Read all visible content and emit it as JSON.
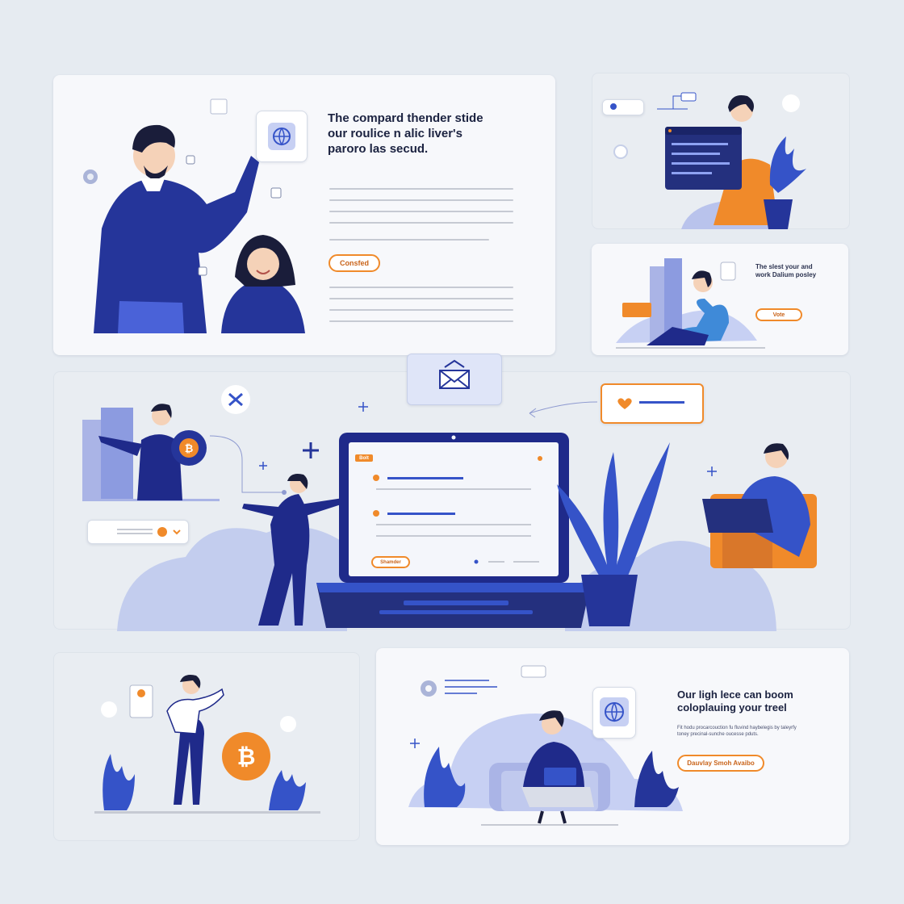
{
  "panels": {
    "top_left": {
      "heading": "The compard thender stide\nour roulice n alic liver's\nparoro las secud.",
      "button_label": "Consfed"
    },
    "mid_right": {
      "heading": "The slest your and\nwork Dalium posley",
      "button_label": "Vote"
    },
    "laptop_screen": {
      "tag_label": "Bolt",
      "button_label": "Shamder"
    },
    "bottom_right": {
      "heading": "Our ligh lece can boom\ncoloplauing your treel",
      "subtext": "Fit hodu procarcouction fu fluvind haybelegis by taleyrfy\ntoney precinal-sunche oucesse pduts.",
      "button_label": "Dauvlay Smoh Avaibo"
    }
  },
  "colors": {
    "navy": "#1f2a8a",
    "blue": "#3553c8",
    "light_blue": "#b9c3ec",
    "orange": "#f08a2a",
    "card": "#f7f8fb",
    "background": "#e6ebf1"
  },
  "icons": [
    "globe-icon",
    "gear-icon",
    "envelope-icon",
    "bitcoin-icon",
    "heart-icon",
    "plus-icon",
    "network-icon",
    "chevron-down-icon"
  ]
}
